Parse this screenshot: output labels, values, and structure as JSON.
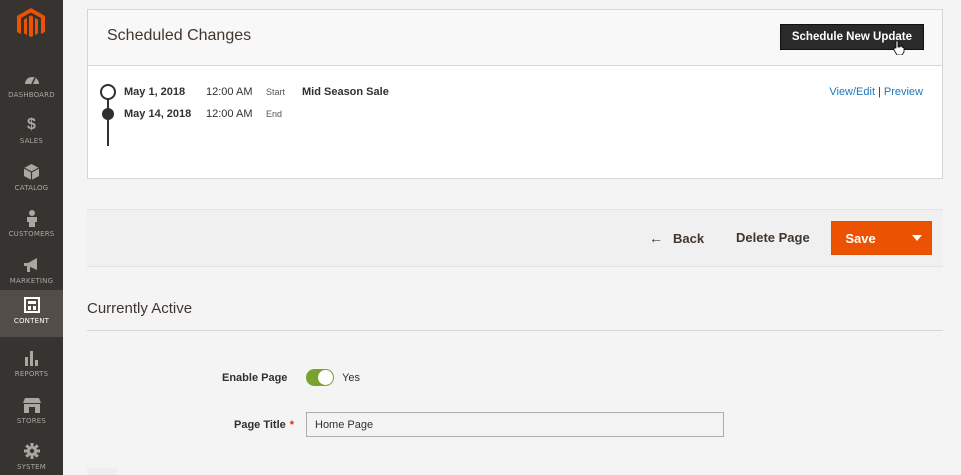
{
  "sidebar": {
    "logo": "magento-logo-icon",
    "items": [
      {
        "label": "DASHBOARD",
        "icon": "speedometer-icon"
      },
      {
        "label": "SALES",
        "icon": "dollar-icon"
      },
      {
        "label": "CATALOG",
        "icon": "box-icon"
      },
      {
        "label": "CUSTOMERS",
        "icon": "person-icon"
      },
      {
        "label": "MARKETING",
        "icon": "megaphone-icon"
      },
      {
        "label": "CONTENT",
        "icon": "layout-icon",
        "active": true
      },
      {
        "label": "REPORTS",
        "icon": "bar-chart-icon"
      },
      {
        "label": "STORES",
        "icon": "storefront-icon"
      },
      {
        "label": "SYSTEM",
        "icon": "gear-icon"
      }
    ]
  },
  "scheduled": {
    "title": "Scheduled Changes",
    "button_label": "Schedule New Update",
    "rows": [
      {
        "date": "May 1, 2018",
        "time": "12:00 AM",
        "kind": "Start",
        "name": "Mid Season Sale"
      },
      {
        "date": "May 14, 2018",
        "time": "12:00 AM",
        "kind": "End",
        "name": ""
      }
    ],
    "links": {
      "view_edit": "View/Edit",
      "separator": "|",
      "preview": "Preview"
    }
  },
  "actions": {
    "back_label": "Back",
    "delete_label": "Delete Page",
    "save_label": "Save"
  },
  "form": {
    "section_title": "Currently Active",
    "enable_label": "Enable Page",
    "enable_value": "Yes",
    "title_label": "Page Title",
    "required_mark": "*",
    "title_value": "Home Page"
  },
  "colors": {
    "sidebar_bg": "#373330",
    "accent": "#eb5202",
    "link": "#1979c3",
    "toggle_on": "#79a22e"
  }
}
